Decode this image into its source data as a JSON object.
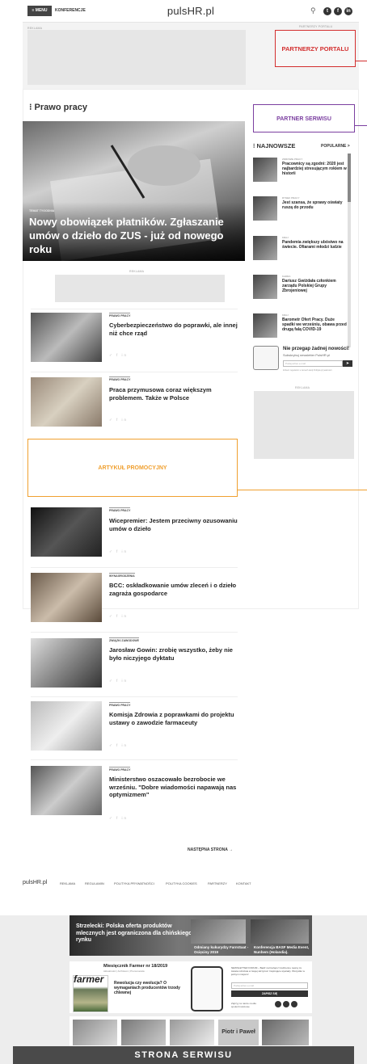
{
  "header": {
    "menu_label": "≡ MENU",
    "konferencje": "KONFERENCJE",
    "logo": "pulsHR.pl"
  },
  "top": {
    "reklama": "REKLAMA",
    "partnerzy_small": "PARTNERZY PORTALU",
    "partnerzy_box": "PARTNERZY PORTALU"
  },
  "section_title": "⁝ Prawo pracy",
  "partner_serwisu": "PARTNER SERWISU",
  "hero": {
    "tag": "TEMAT TYGODNIA",
    "title": "Nowy obowiązek płatników. Zgłaszanie umów o dzieło do ZUS - już od nowego roku"
  },
  "mid_ad_label": "REKLAMA",
  "articles": [
    {
      "cat": "PRAWO PRACY",
      "title": "Cyberbezpieczeństwo do poprawki, ale innej niż chce rząd"
    },
    {
      "cat": "PRAWO PRACY",
      "title": "Praca przymusowa coraz większym problemem. Także w Polsce"
    },
    {
      "cat": "PRAWO PRACY",
      "title": "Wicepremier: Jestem przeciwny ozusowaniu umów o dzieło"
    },
    {
      "cat": "WYNAGRODZENIA",
      "title": "BCC: oskładkowanie umów zleceń i o dzieło zagraża gospodarce"
    },
    {
      "cat": "ZWIĄZKI ZAWODOWE",
      "title": "Jarosław Gowin: zrobię wszystko, żeby nie było niczyjego dyktatu"
    },
    {
      "cat": "PRAWO PRACY",
      "title": "Komisja Zdrowia z poprawkami do projektu ustawy o zawodzie farmaceuty"
    },
    {
      "cat": "PRAWO PRACY",
      "title": "Ministerstwo oszacowało bezrobocie we wrześniu. \"Dobre wiadomości napawają nas optymizmem\""
    }
  ],
  "share_text": "✓  f  in",
  "promo": "ARTYKUŁ PROMOCYJNY",
  "sidebar": {
    "najnowsze": "⁝ NAJNOWSZE",
    "popularne": "POPULARNE >",
    "items": [
      {
        "cat": "ZDROWIE PRACY",
        "title": "Pracownicy są zgodni: 2020 jest najbardziej stresującym rokiem w historii"
      },
      {
        "cat": "RYNEK PRACY",
        "title": "Jest szansa, że sprawy oświaty ruszą do przodu"
      },
      {
        "cat": "KRAJ",
        "title": "Pandemia zwiększy ubóstwo na świecie. Ofiarami młodzi ludzie"
      },
      {
        "cat": "KADRA",
        "title": "Dariusz Gwiżdała członkiem zarządu Polskiej Grupy Zbrojeniowej"
      },
      {
        "cat": "KRAJ",
        "title": "Barometr Ofert Pracy. Duże spadki we wrześniu, obawa przed drugą falą COVID-19"
      }
    ],
    "newsletter_title": "Nie przegap żadnej nowości!",
    "newsletter_sub": "Subskrybuj newsletter PulsHR.pl",
    "newsletter_placeholder": "Podaj adres e-mail",
    "newsletter_btn": "➤",
    "newsletter_fine": "Zobacz regulamin w ramach akcji Polityka prywatności",
    "reklama": "REKLAMA"
  },
  "next_page": "NASTĘPNA STRONA →",
  "footer": {
    "logo": "pulsHR.pl",
    "links": [
      "REKLAMA",
      "REGULAMIN",
      "POLITYKA PRYWATNOŚCI",
      "POLITYKA COOKIES",
      "PARTNERZY",
      "KONTAKT"
    ]
  },
  "screenshot_section": {
    "headline": "Strzelecki: Polska oferta produktów mlecznych jest ograniczona dla chińskiego rynku",
    "thumb1": "Odmiany kukurydzy FarmSaat - Ocięciny 2019",
    "thumb2": "Konferencja BASF Media Event, Nunhem (Holandia).",
    "mag_title": "Miesięcznik Farmer nr 18/2019",
    "mag_sub": "Aktualności | Archiwum | Prenumerata",
    "farmer_logo": "farmer",
    "question": "Rewolucja czy ewolucja? O wymaganiach producentów trzody chlewnej",
    "nl_text": "NEWSLETTER FORUM – Bądź na bieżąco! Codzienne newsy ze świata rolnictwa w twojej skrzynce! Inspirujące wywiady. Wszystko w jednym miejscu!",
    "nl_placeholder": "Podaj adres e-mail",
    "nl_btn": "ZAPISZ SIĘ",
    "socs_label": "Zajrzyj na nasze media społecznościowe",
    "piotr": "Piotr i Paweł",
    "footer_label": "STRONA SERWISU"
  }
}
